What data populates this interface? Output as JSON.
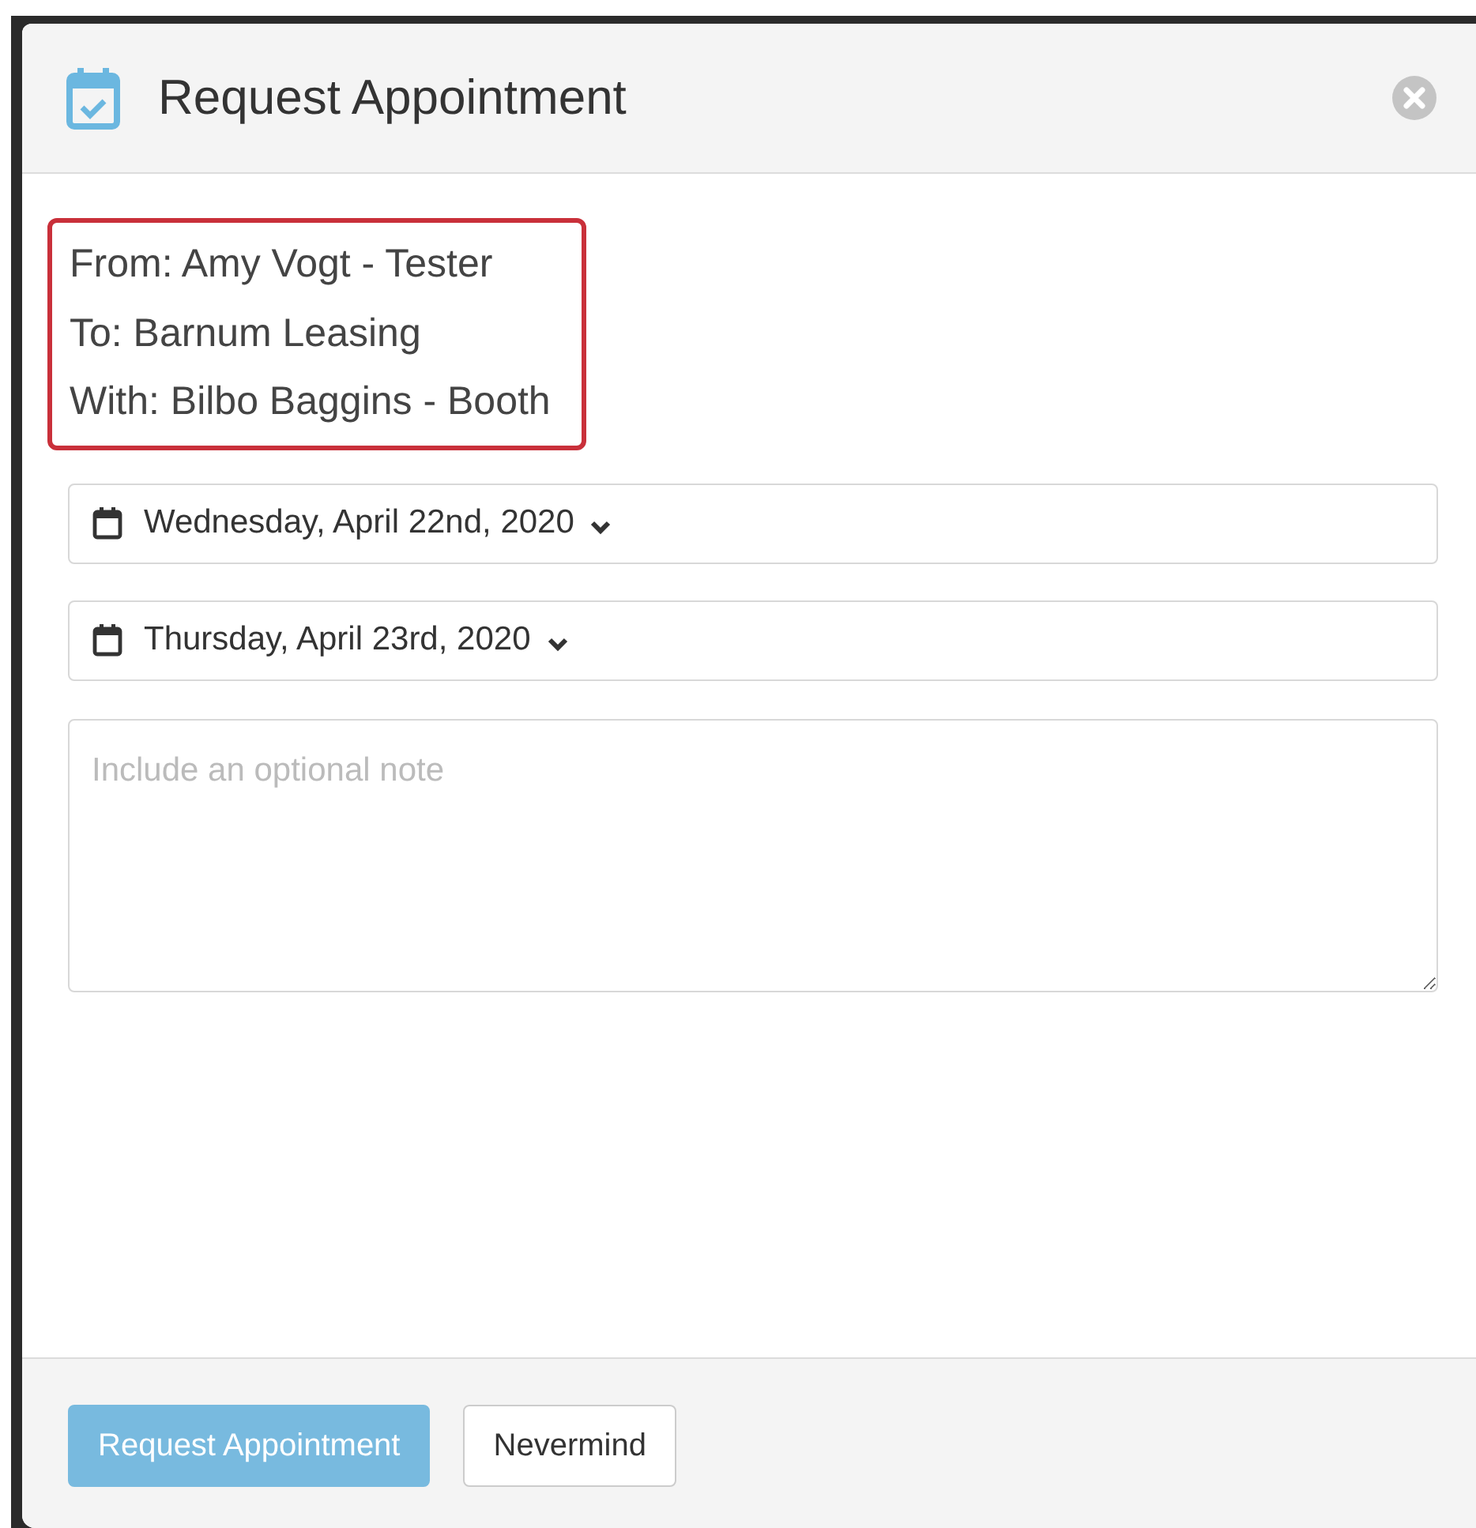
{
  "dialog": {
    "title": "Request Appointment",
    "details": [
      "From: Amy Vogt - Tester",
      "To: Barnum Leasing",
      "With: Bilbo Baggins - Booth"
    ],
    "dates": [
      {
        "value": "Wednesday, April 22nd, 2020"
      },
      {
        "value": "Thursday, April 23rd, 2020"
      }
    ],
    "note": {
      "placeholder": "Include an optional note"
    },
    "buttons": [
      {
        "label": "Request Appointment",
        "kind": "primary",
        "disabled": true
      },
      {
        "label": "Nevermind",
        "kind": "secondary",
        "disabled": false
      }
    ]
  }
}
